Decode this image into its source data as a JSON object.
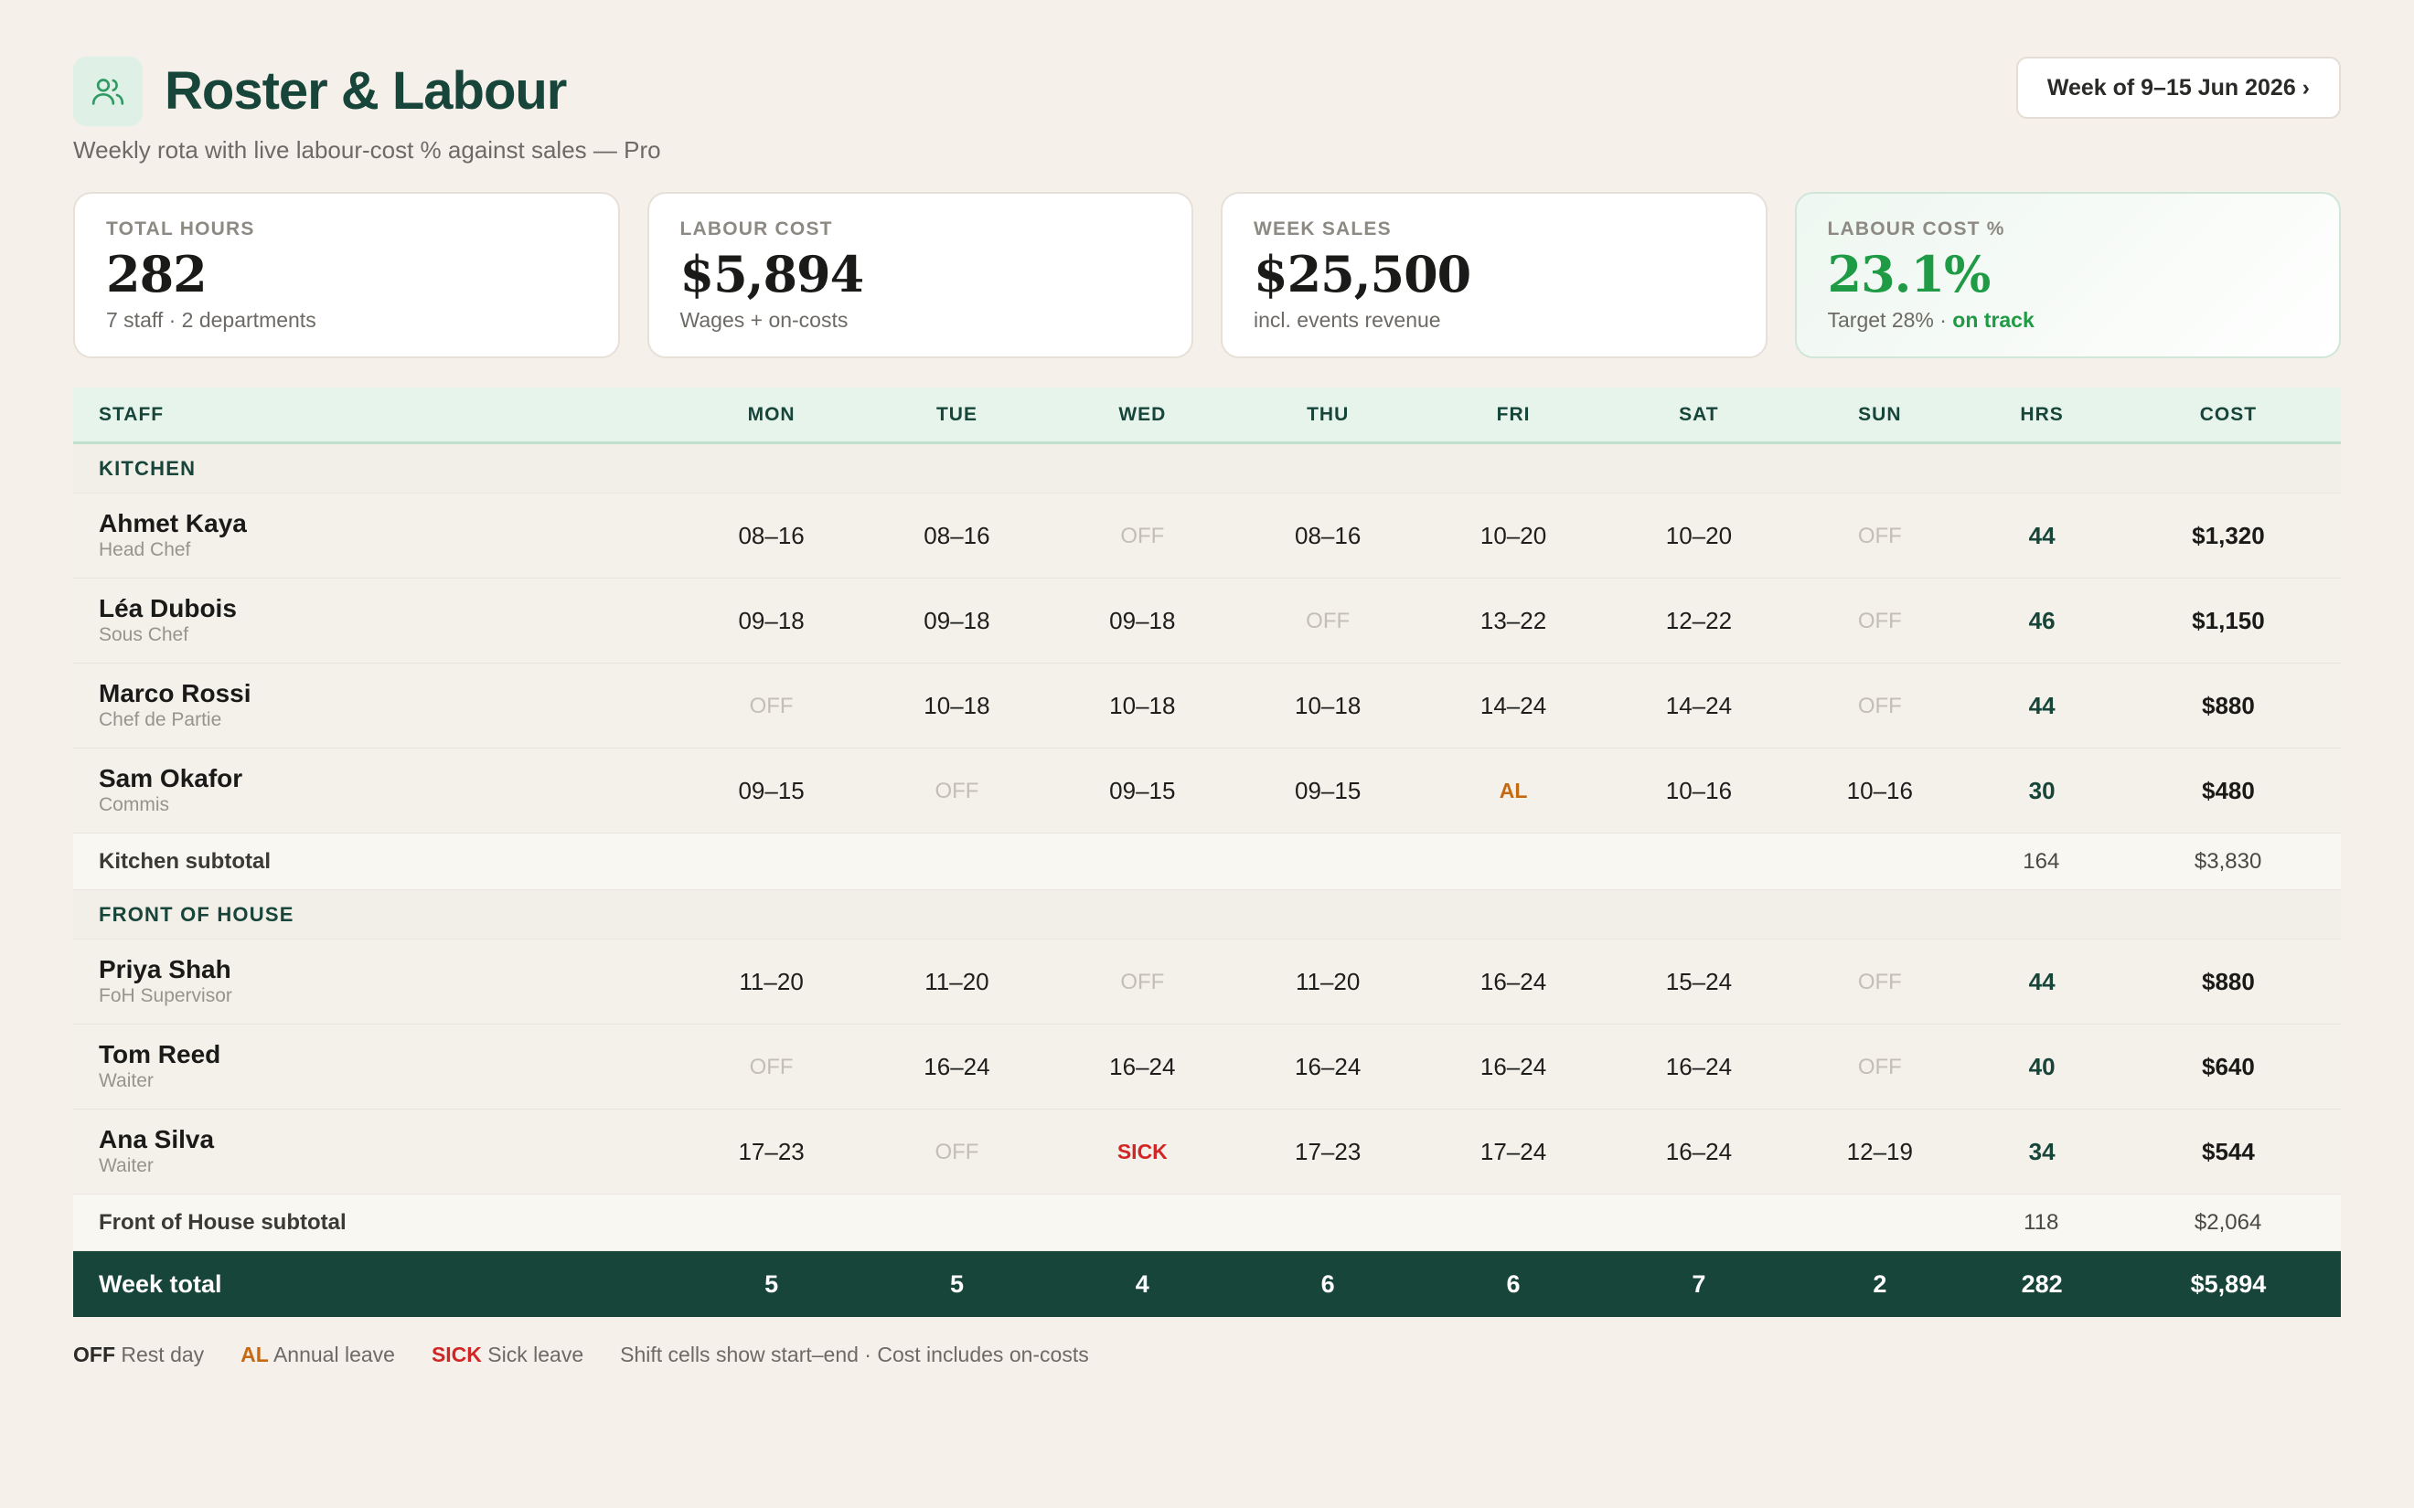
{
  "header": {
    "title": "Roster & Labour",
    "subtitle": "Weekly rota with live labour-cost % against sales — Pro",
    "week_button": "Week of 9–15 Jun 2026 ›",
    "icon": "users-icon"
  },
  "kpis": [
    {
      "label": "TOTAL HOURS",
      "value": "282",
      "sub": "7 staff · 2 departments"
    },
    {
      "label": "LABOUR COST",
      "value": "$5,894",
      "sub": "Wages + on-costs"
    },
    {
      "label": "WEEK SALES",
      "value": "$25,500",
      "sub": "incl. events revenue"
    },
    {
      "label": "LABOUR COST %",
      "value": "23.1%",
      "sub": "Target 28% · ",
      "status": "on track"
    }
  ],
  "table": {
    "headers": {
      "staff": "STAFF",
      "mon": "MON",
      "tue": "TUE",
      "wed": "WED",
      "thu": "THU",
      "fri": "FRI",
      "sat": "SAT",
      "sun": "SUN",
      "hrs": "HRS",
      "cost": "COST"
    },
    "kitchen": {
      "label": "KITCHEN",
      "rows": [
        {
          "name": "Ahmet Kaya",
          "role": "Head Chef",
          "shifts": [
            "08–16",
            "08–16",
            "OFF",
            "08–16",
            "10–20",
            "10–20",
            "OFF"
          ],
          "hrs": "44",
          "cost": "$1,320"
        },
        {
          "name": "Léa Dubois",
          "role": "Sous Chef",
          "shifts": [
            "09–18",
            "09–18",
            "09–18",
            "OFF",
            "13–22",
            "12–22",
            "OFF"
          ],
          "hrs": "46",
          "cost": "$1,150"
        },
        {
          "name": "Marco Rossi",
          "role": "Chef de Partie",
          "shifts": [
            "OFF",
            "10–18",
            "10–18",
            "10–18",
            "14–24",
            "14–24",
            "OFF"
          ],
          "hrs": "44",
          "cost": "$880"
        },
        {
          "name": "Sam Okafor",
          "role": "Commis",
          "shifts": [
            "09–15",
            "OFF",
            "09–15",
            "09–15",
            "AL",
            "10–16",
            "10–16"
          ],
          "hrs": "30",
          "cost": "$480"
        }
      ],
      "subtotal": {
        "label": "Kitchen subtotal",
        "hrs": "164",
        "cost": "$3,830"
      }
    },
    "foh": {
      "label": "FRONT OF HOUSE",
      "rows": [
        {
          "name": "Priya Shah",
          "role": "FoH Supervisor",
          "shifts": [
            "11–20",
            "11–20",
            "OFF",
            "11–20",
            "16–24",
            "15–24",
            "OFF"
          ],
          "hrs": "44",
          "cost": "$880"
        },
        {
          "name": "Tom Reed",
          "role": "Waiter",
          "shifts": [
            "OFF",
            "16–24",
            "16–24",
            "16–24",
            "16–24",
            "16–24",
            "OFF"
          ],
          "hrs": "40",
          "cost": "$640"
        },
        {
          "name": "Ana Silva",
          "role": "Waiter",
          "shifts": [
            "17–23",
            "OFF",
            "SICK",
            "17–23",
            "17–24",
            "16–24",
            "12–19"
          ],
          "hrs": "34",
          "cost": "$544"
        }
      ],
      "subtotal": {
        "label": "Front of House subtotal",
        "hrs": "118",
        "cost": "$2,064"
      }
    },
    "total": {
      "label": "Week total",
      "days": [
        "5",
        "5",
        "4",
        "6",
        "6",
        "7",
        "2"
      ],
      "hrs": "282",
      "cost": "$5,894"
    }
  },
  "legend": {
    "off_code": "OFF",
    "off_text": "Rest day",
    "al_code": "AL",
    "al_text": "Annual leave",
    "sick_code": "SICK",
    "sick_text": "Sick leave",
    "note": "Shift cells show start–end · Cost includes on-costs"
  },
  "colors": {
    "brand": "#17453a",
    "accent_green": "#1f9a45",
    "annual_leave": "#c56a12",
    "sick": "#d02626",
    "background": "#f5f0ea"
  }
}
